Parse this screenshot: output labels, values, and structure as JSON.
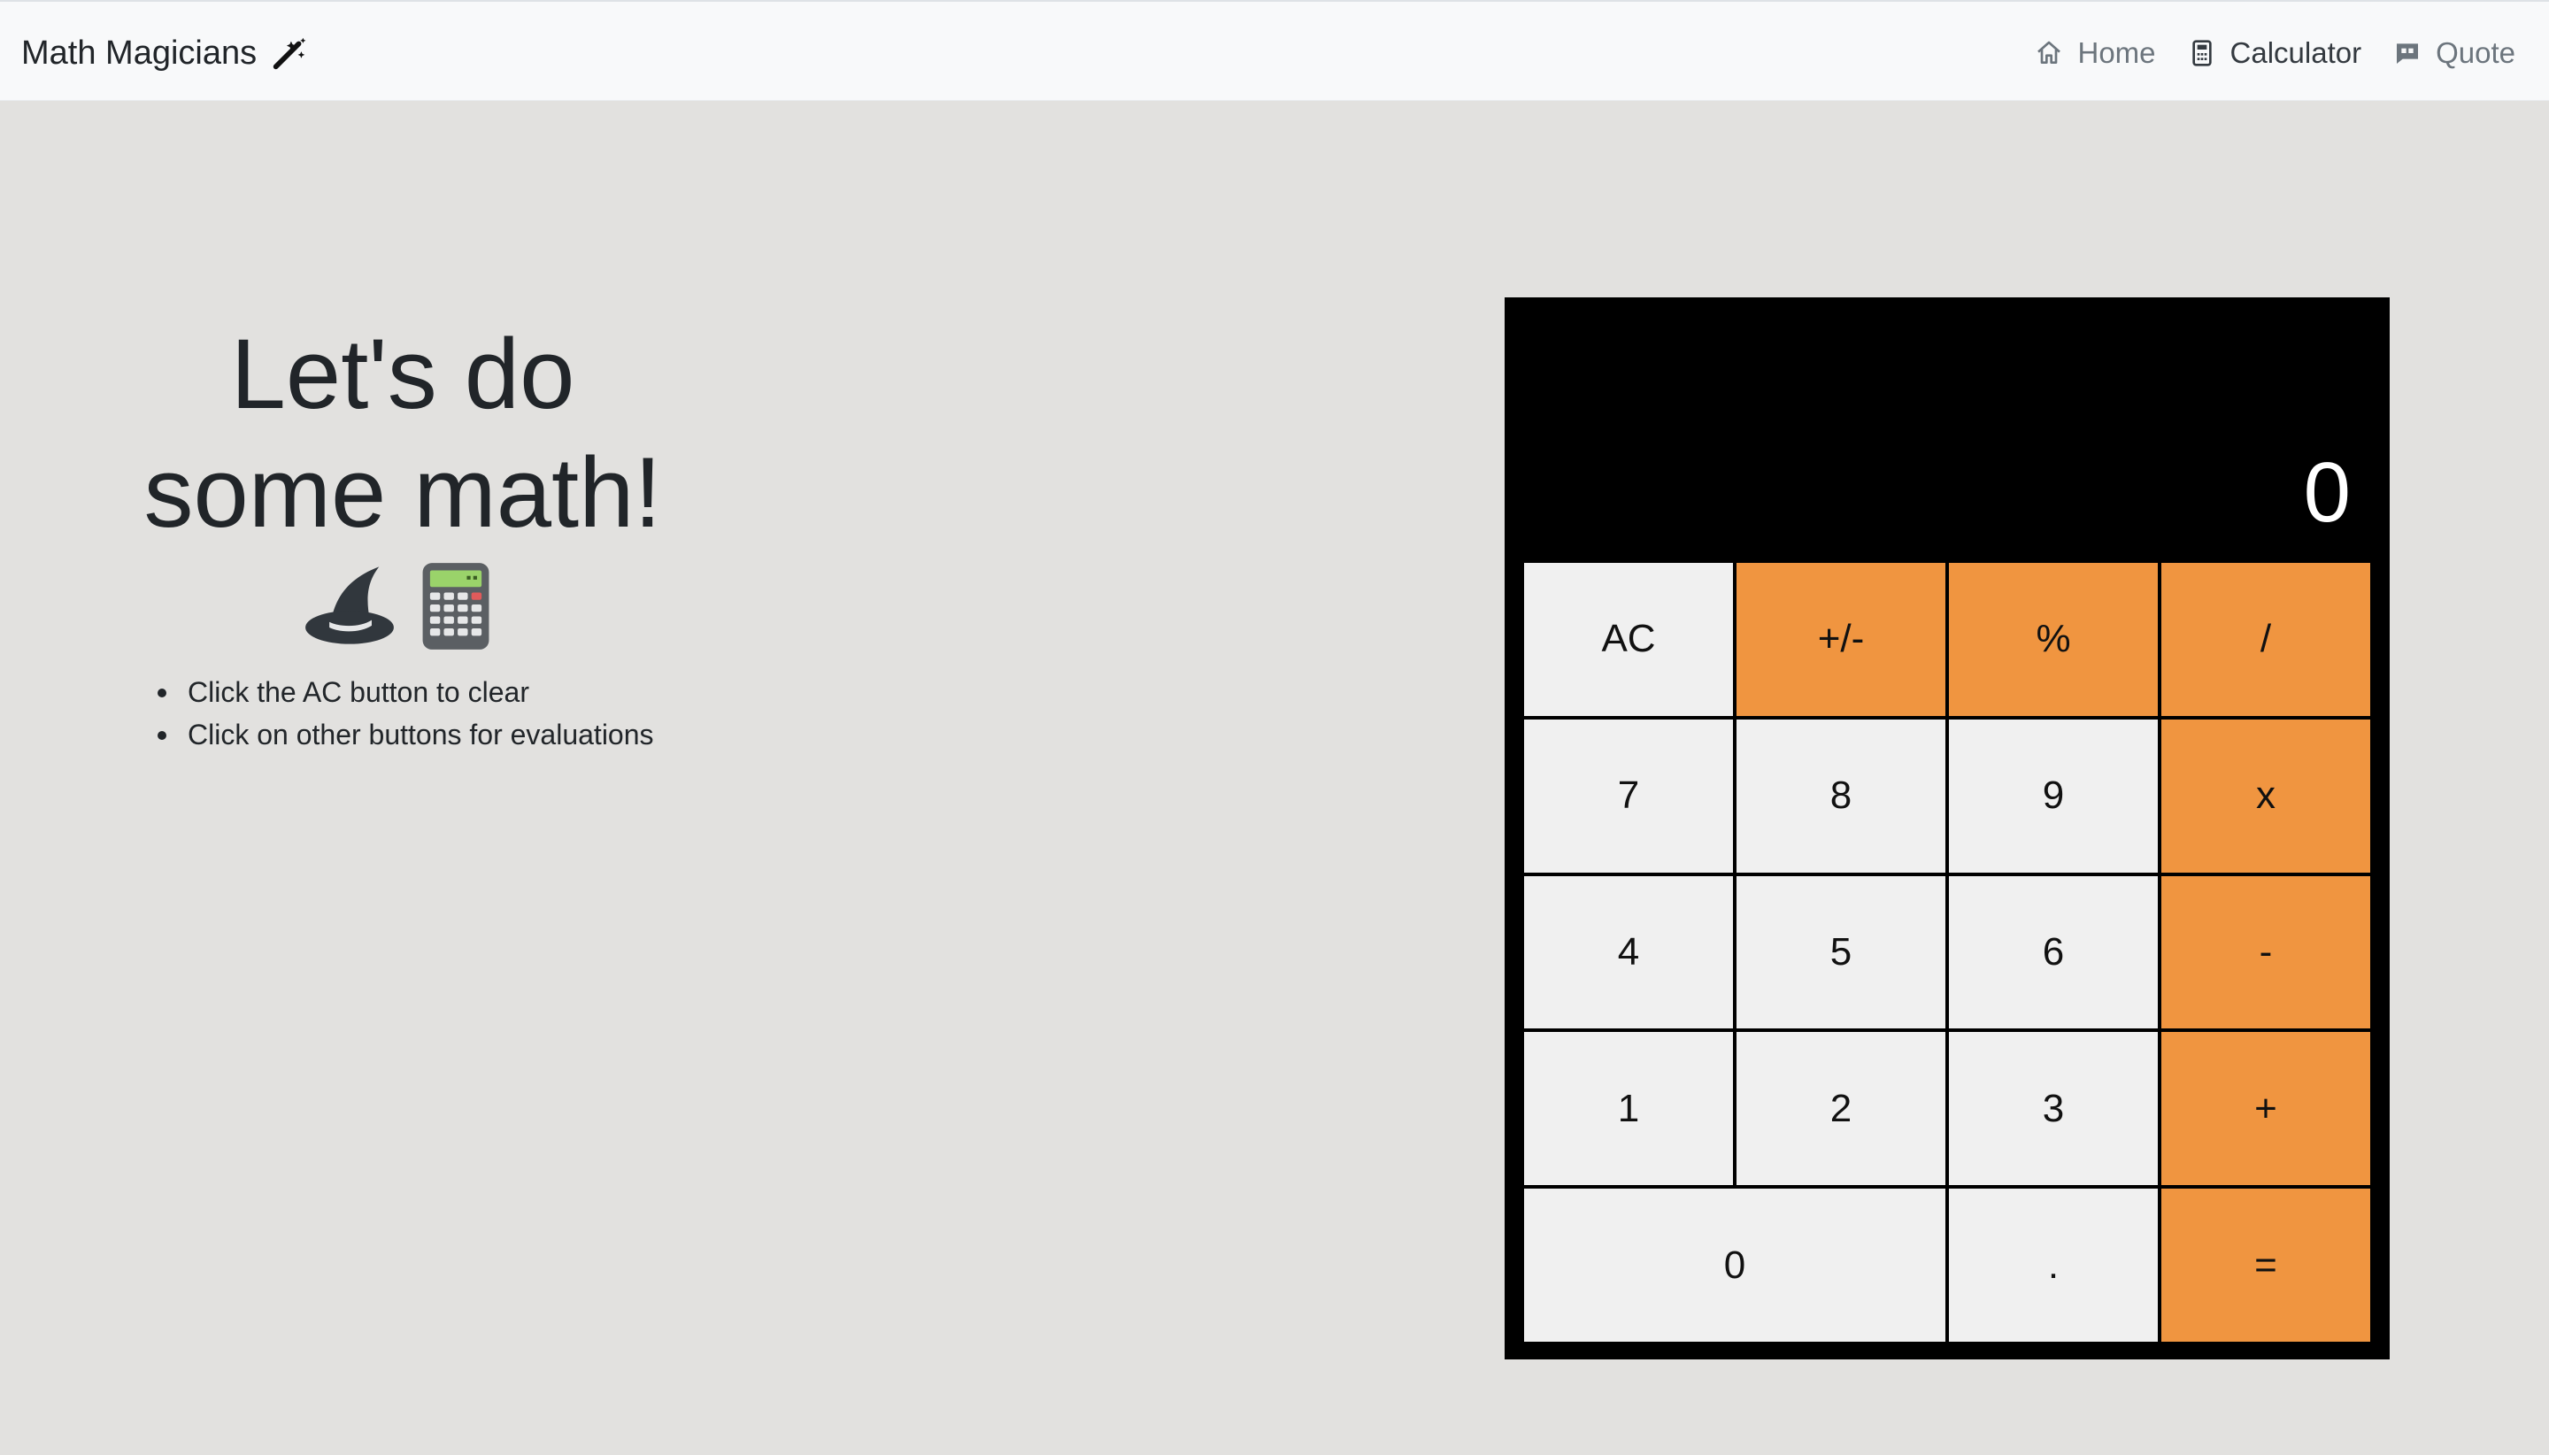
{
  "navbar": {
    "brand": "Math Magicians",
    "brand_icon": "magic-wand-icon",
    "links": [
      {
        "label": "Home",
        "icon": "house-icon",
        "active": false
      },
      {
        "label": "Calculator",
        "icon": "calculator-icon",
        "active": true
      },
      {
        "label": "Quote",
        "icon": "quote-icon",
        "active": false
      }
    ]
  },
  "intro": {
    "headline_line1": "Let's do",
    "headline_line2": "some math!",
    "emojis": [
      "wizard-hat-icon",
      "calculator-emoji-icon"
    ],
    "tips": [
      "Click the AC button to clear",
      "Click on other buttons for evaluations"
    ]
  },
  "calculator": {
    "display": "0",
    "keys": [
      {
        "label": "AC",
        "style": "light"
      },
      {
        "label": "+/-",
        "style": "orange"
      },
      {
        "label": "%",
        "style": "orange"
      },
      {
        "label": "/",
        "style": "orange"
      },
      {
        "label": "7",
        "style": "light"
      },
      {
        "label": "8",
        "style": "light"
      },
      {
        "label": "9",
        "style": "light"
      },
      {
        "label": "x",
        "style": "orange"
      },
      {
        "label": "4",
        "style": "light"
      },
      {
        "label": "5",
        "style": "light"
      },
      {
        "label": "6",
        "style": "light"
      },
      {
        "label": "-",
        "style": "orange"
      },
      {
        "label": "1",
        "style": "light"
      },
      {
        "label": "2",
        "style": "light"
      },
      {
        "label": "3",
        "style": "light"
      },
      {
        "label": "+",
        "style": "orange"
      },
      {
        "label": "0",
        "style": "light"
      },
      {
        "label": ".",
        "style": "light"
      },
      {
        "label": "=",
        "style": "orange"
      }
    ]
  },
  "colors": {
    "page_bg": "#e2e1df",
    "navbar_bg": "#f8f9fa",
    "accent_orange": "#f09540",
    "key_light": "#f0f0f0",
    "display_bg": "#000000"
  }
}
